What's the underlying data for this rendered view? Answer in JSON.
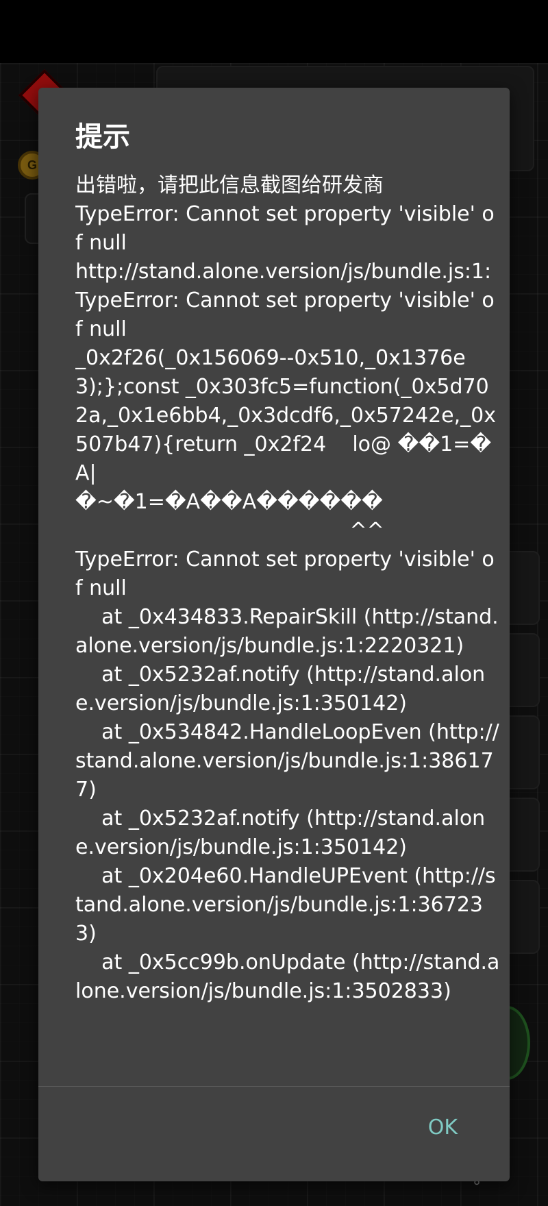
{
  "dialog": {
    "title": "提示",
    "message": "出错啦，请把此信息截图给研发商\nTypeError: Cannot set property 'visible' of null\nhttp://stand.alone.version/js/bundle.js:1:\nTypeError: Cannot set property 'visible' of null\n_0x2f26(_0x156069--0x510,_0x1376e3);};const _0x303fc5=function(_0x5d702a,_0x1e6bb4,_0x3dcdf6,_0x57242e,_0x507b47){return _0x2f24    lo@ ��1=�A|\n�~�1=�A��A������\n                                          ^^\nTypeError: Cannot set property 'visible' of null\n    at _0x434833.RepairSkill (http://stand.alone.version/js/bundle.js:1:2220321)\n    at _0x5232af.notify (http://stand.alone.version/js/bundle.js:1:350142)\n    at _0x534842.HandleLoopEven (http://stand.alone.version/js/bundle.js:1:386177)\n    at _0x5232af.notify (http://stand.alone.version/js/bundle.js:1:350142)\n    at _0x204e60.HandleUPEvent (http://stand.alone.version/js/bundle.js:1:367233)\n    at _0x5cc99b.onUpdate (http://stand.alone.version/js/bundle.js:1:3502833)",
    "ok_label": "OK"
  },
  "background": {
    "coin_letter": "G",
    "key_icon": "key-icon",
    "accent_color": "#80cbc4",
    "dialog_color": "#424242"
  }
}
